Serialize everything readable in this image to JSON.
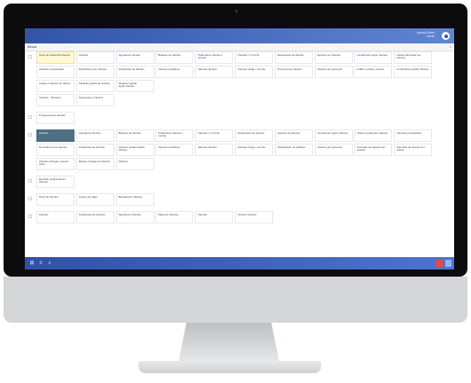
{
  "window": {
    "title": "Menus",
    "close_glyph": "×"
  },
  "user": {
    "name": "Usuario Demo\nAdmin",
    "avatar_icon": "user-avatar-icon"
  },
  "groups": [
    {
      "icon": "☐",
      "rows": [
        [
          "Tipos de tendencia clientes",
          "Clientes",
          "Agenda de clientes",
          "Bloqueo de clientes",
          "Parámetros clientes y cuenta",
          "Clientes y C.N.A.E.",
          "Descuentos de clientes",
          "Agentes por clientes",
          "Comisiones según clientes",
          "Claves bancarias por clientes"
        ],
        [
          "Clientes provisionales",
          "Domicilios envío clientes",
          "Incidencias de clientes",
          "Clientes periódicos",
          "Alarmas clientes",
          "Clientes riesgo y cuenta",
          "Promociones clientes",
          "Clientes por personas",
          "Gráfico ventas y cuenta",
          "Condiciones pedido clientes"
        ],
        [
          "Cartas a clientes sin docum.",
          "Situación global de clientes",
          "Situación global agrup.clientes"
        ],
        [
          "Clientes - Informes",
          "Segmentos y clientes"
        ]
      ]
    },
    {
      "icon": "☐",
      "rows": [
        [
          "Prospecciones clientes"
        ]
      ]
    },
    {
      "icon": "☐",
      "rows": [
        [
          "Clientes",
          "Agenda de clientes",
          "Bloqueo de clientes",
          "Parámetros clientes y cuenta",
          "Clientes y C.N.A.E.",
          "Descuentos de clientes",
          "Agentes de clientes",
          "Comisiones según clientes",
          "Claves comisiones clientes",
          "Clientes provisionales"
        ],
        [
          "Domicilios envío clientes",
          "Incidencias de clientes",
          "Clientes preferenciales clientes",
          "Clientes periódicos",
          "Alarmas clientes",
          "Clientes riesgo y cuenta",
          "Planificación de pedidos",
          "Clientes por personas",
          "Fórmulas de clientes por artículo",
          "Fórmulas de clientes por cliente"
        ],
        [
          "Clientes entrega y reparto aviso",
          "Riesgo entrega por clientes",
          "Clientes"
        ]
      ]
    },
    {
      "icon": "☐",
      "rows": [
        [
          "Revisión programación clientes"
        ]
      ]
    },
    {
      "icon": "☐",
      "rows": [
        [
          "Tipos de clientes",
          "Grupos de pago",
          "Buscadores Clientes"
        ]
      ]
    },
    {
      "icon": "☐",
      "rows": [
        [
          "Clientes",
          "Incidencias de Clientes",
          "Agenda de Clientes",
          "Mapa de Clientes",
          "Clientes",
          "Informe Clientes"
        ]
      ]
    }
  ],
  "taskbar": {
    "icons": [
      "windows-icon",
      "menu-icon",
      "search-icon"
    ],
    "glyphs": [
      "⊞",
      "≡",
      "⌕"
    ]
  }
}
